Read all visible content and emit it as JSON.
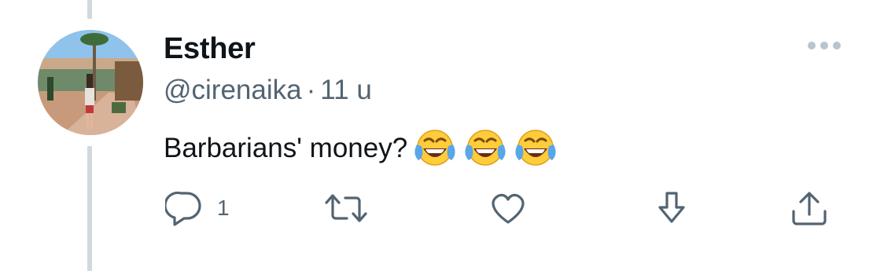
{
  "tweet": {
    "author": {
      "display_name": "Esther",
      "handle": "@cirenaika"
    },
    "separator": "·",
    "timestamp": "11 u",
    "text": "Barbarians' money?",
    "emojis": [
      "face-with-tears-of-joy",
      "face-with-tears-of-joy",
      "face-with-tears-of-joy"
    ]
  },
  "actions": {
    "reply": {
      "icon": "reply-icon",
      "count": "1"
    },
    "retweet": {
      "icon": "retweet-icon"
    },
    "like": {
      "icon": "heart-icon"
    },
    "save": {
      "icon": "download-arrow-icon"
    },
    "share": {
      "icon": "share-icon"
    }
  },
  "colors": {
    "text": "#0f1419",
    "secondary": "#536471",
    "thread_line": "#cfd9de",
    "more_dots": "#b9c4cc"
  }
}
